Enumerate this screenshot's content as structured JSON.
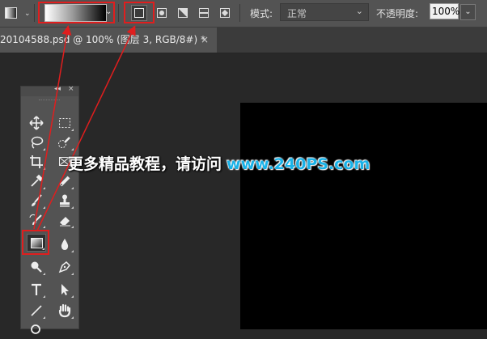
{
  "options_bar": {
    "tool_icon": "gradient-tool-icon",
    "gradient_types": [
      "linear-gradient",
      "radial-gradient",
      "angle-gradient",
      "reflected-gradient",
      "diamond-gradient"
    ],
    "mode_label": "模式:",
    "mode_value": "正常",
    "opacity_label": "不透明度:",
    "opacity_value": "100%"
  },
  "document": {
    "tab_title": "20104588.psd @ 100% (图层 3, RGB/8#) *",
    "close_glyph": "×"
  },
  "toolbox": {
    "collapse_glyph": "◂◂",
    "close_glyph": "×",
    "tools": [
      "move-tool",
      "marquee-tool",
      "lasso-tool",
      "quick-selection-tool",
      "crop-tool",
      "frame-tool",
      "eyedropper-tool",
      "healing-brush-tool",
      "brush-tool",
      "clone-stamp-tool",
      "history-brush-tool",
      "eraser-tool",
      "gradient-tool",
      "blur-tool",
      "dodge-tool",
      "pen-tool",
      "type-tool",
      "path-selection-tool",
      "line-tool",
      "hand-tool",
      "zoom-tool"
    ]
  },
  "watermark": {
    "text_cn": "更多精品教程，请访问",
    "url": "www.240PS.com"
  },
  "colors": {
    "highlight": "#e01e1e",
    "panel": "#535353",
    "canvas": "#000000",
    "workspace": "#282828",
    "url_color": "#19b2e8"
  }
}
